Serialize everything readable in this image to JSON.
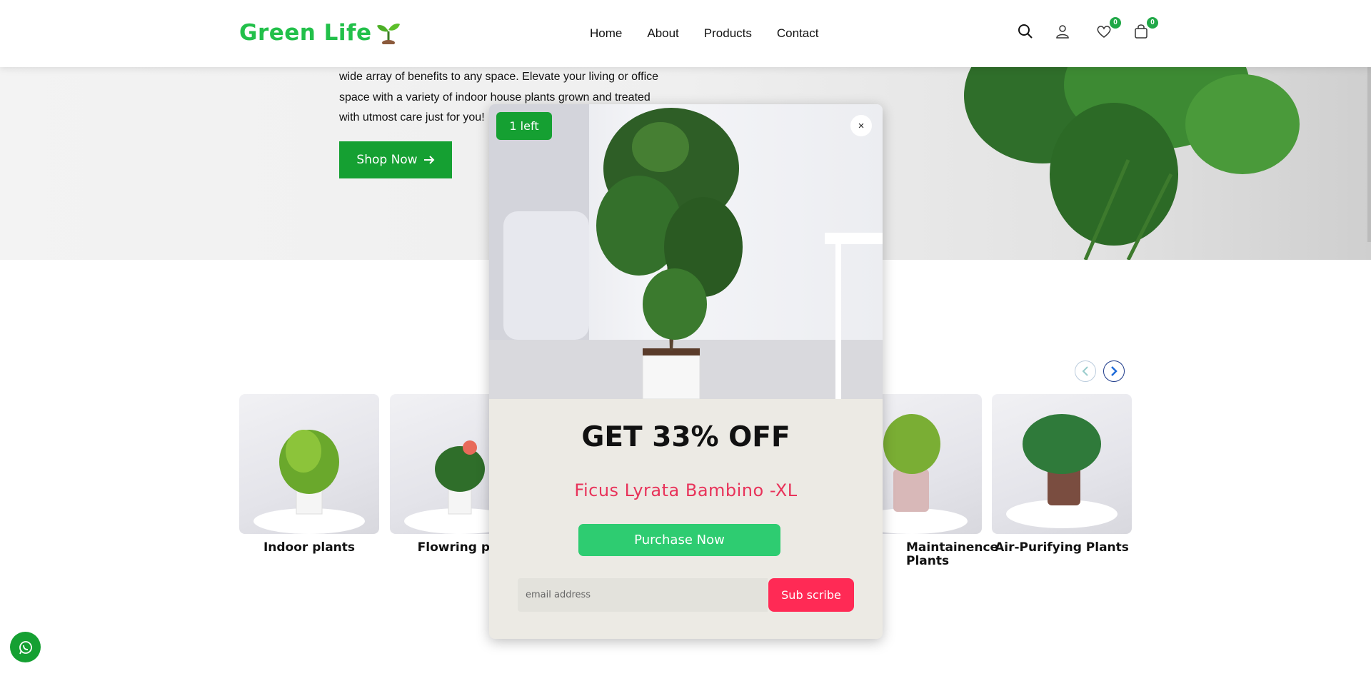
{
  "header": {
    "logo": "Green Life",
    "nav": [
      "Home",
      "About",
      "Products",
      "Contact"
    ],
    "wishlist_count": "0",
    "cart_count": "0"
  },
  "hero": {
    "lines": [
      "wide array of benefits to any space. Elevate your living or office",
      "space with a variety of indoor house plants grown and treated",
      "with utmost care just for you!"
    ],
    "shop_label": "Shop Now"
  },
  "categories": [
    {
      "name": "Indoor plants"
    },
    {
      "name": "Flowring pla"
    },
    {
      "name": "Maintainence Plants"
    },
    {
      "name": "Air-Purifying Plants"
    }
  ],
  "popup": {
    "stock_badge": "1 left",
    "close_symbol": "×",
    "offer": "GET 33% OFF",
    "product_name": "Ficus Lyrata Bambino -XL",
    "purchase_label": "Purchase Now",
    "email_placeholder": "email address",
    "subscribe_label": "Sub scribe"
  },
  "colors": {
    "brand_green": "#22c04a",
    "button_green": "#15a032",
    "purchase_green": "#2ecc71",
    "accent_pink": "#ff2a55"
  }
}
